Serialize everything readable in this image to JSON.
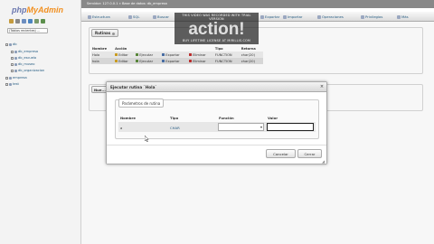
{
  "nav": {
    "logo_php": "php",
    "logo_admin": "MyAdmin",
    "db_select": "(Tablas recientes) ...",
    "tree": [
      {
        "label": "db",
        "depth": 0
      },
      {
        "label": "db_empresa",
        "depth": 1
      },
      {
        "label": "db_escuela",
        "depth": 1
      },
      {
        "label": "db_museo",
        "depth": 1
      },
      {
        "label": "db_organizacion",
        "depth": 1
      },
      {
        "label": "empresa",
        "depth": 0
      },
      {
        "label": "test",
        "depth": 0
      }
    ]
  },
  "topbar": {
    "breadcrumb": "Servidor: 127.0.0.1 » Base de datos: db_empresa"
  },
  "tabs": [
    {
      "label": "Estructura"
    },
    {
      "label": "SQL"
    },
    {
      "label": "Buscar"
    },
    {
      "label": "Generar una consulta"
    },
    {
      "label": "Exportar"
    },
    {
      "label": "Importar"
    },
    {
      "label": "Operaciones"
    },
    {
      "label": "Privilegios"
    },
    {
      "label": "Más"
    }
  ],
  "watermark": {
    "top": "THIS VIDEO WAS RECORDED WITH TRIAL VERSION",
    "big": "action!",
    "bottom": "BUY LIFETIME LICENSE AT MIRILLIS.COM"
  },
  "routines": {
    "legend": "Rutinas",
    "headers": [
      "Nombre",
      "Acción",
      "",
      "",
      "",
      "Tipo",
      "Retorna"
    ],
    "rows": [
      {
        "name": "Hola",
        "edit": "Editar",
        "exec": "Ejecutar",
        "export": "Exportar",
        "delete": "Eliminar",
        "type": "FUNCTION",
        "returns": "char(20)"
      },
      {
        "name": "hola",
        "edit": "Editar",
        "exec": "Ejecutar",
        "export": "Exportar",
        "delete": "Eliminar",
        "type": "FUNCTION",
        "returns": "char(20)"
      }
    ]
  },
  "new_panel": {
    "legend": "Nue..."
  },
  "dialog": {
    "title": "Ejecutar rutina `Hola`",
    "close": "×",
    "fieldset_legend": "Parámetros de rutina",
    "headers": {
      "name": "Nombre",
      "type": "Tipo",
      "function": "Función",
      "value": "Valor"
    },
    "param": {
      "name": "a",
      "type": "CHAR",
      "function": "",
      "value": ""
    },
    "cancel": "Cancelar",
    "execute": "Cerrar"
  }
}
